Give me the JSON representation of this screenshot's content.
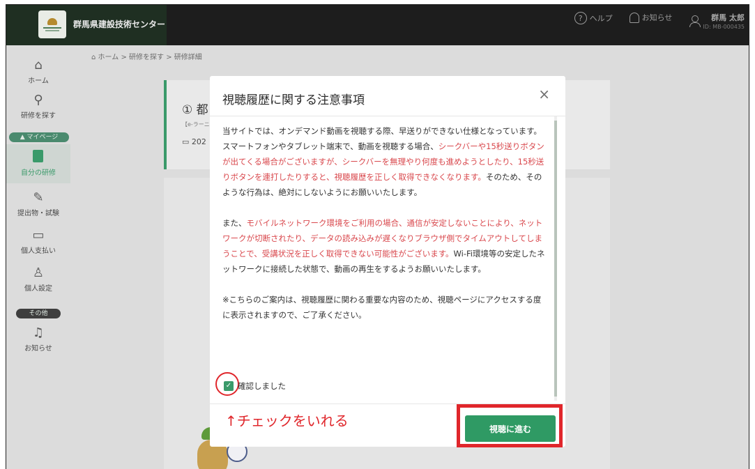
{
  "header": {
    "site_title": "群馬県建設技術センター",
    "help_label": "ヘルプ",
    "notice_label": "お知らせ",
    "user_name": "群馬 太郎",
    "user_id": "ID: MB-000435"
  },
  "sidebar": {
    "items": [
      {
        "label": "ホーム",
        "icon": "home-icon"
      },
      {
        "label": "研修を探す",
        "icon": "search-icon"
      },
      {
        "label": "マイページ",
        "icon": "section-pill"
      },
      {
        "label": "自分の研修",
        "icon": "bookmark-icon"
      },
      {
        "label": "提出物・試験",
        "icon": "edit-icon"
      },
      {
        "label": "個人支払い",
        "icon": "card-icon"
      },
      {
        "label": "個人設定",
        "icon": "person-icon"
      },
      {
        "label": "その他",
        "icon": "section-pill"
      },
      {
        "label": "お知らせ",
        "icon": "bell-icon"
      }
    ]
  },
  "breadcrumb": {
    "home": "ホーム",
    "search": "研修を探す",
    "current": "研修詳細"
  },
  "card": {
    "title_partial": "① 都",
    "subtitle_partial": "【e-ラーニ",
    "date_partial": "202"
  },
  "modal": {
    "title": "視聴履歴に関する注意事項",
    "close": "×",
    "p1_a": "当サイトでは、オンデマンド動画を視聴する際、早送りができない仕様となっています。スマートフォンやタブレット端末で、動画を視聴する場合、",
    "p1_red": "シークバーや15秒送りボタンが出てくる場合がございますが、シークバーを無理やり何度も進めようとしたり、15秒送りボタンを連打したりすると、視聴履歴を正しく取得できなくなります。",
    "p1_b": "そのため、そのような行為は、絶対にしないようにお願いいたします。",
    "p2_a": "また、",
    "p2_red": "モバイルネットワーク環境をご利用の場合、通信が安定しないことにより、ネットワークが切断されたり、データの読み込みが遅くなりブラウザ側でタイムアウトしてしまうことで、受講状況を正しく取得できない可能性がございます。",
    "p2_b": "Wi-Fi環境等の安定したネットワークに接続した状態で、動画の再生をするようお願いいたします。",
    "p3": "※こちらのご案内は、視聴履歴に関わる重要な内容のため、視聴ページにアクセスする度に表示されますので、ご了承ください。",
    "confirm_label": "確認しました",
    "confirm_checked": true,
    "annotation": "↑チェックをいれる",
    "proceed_button": "視聴に進む"
  },
  "colors": {
    "accent_green": "#2f9a64",
    "warning_red": "#d9484d",
    "annotation_red": "#e0262b"
  }
}
